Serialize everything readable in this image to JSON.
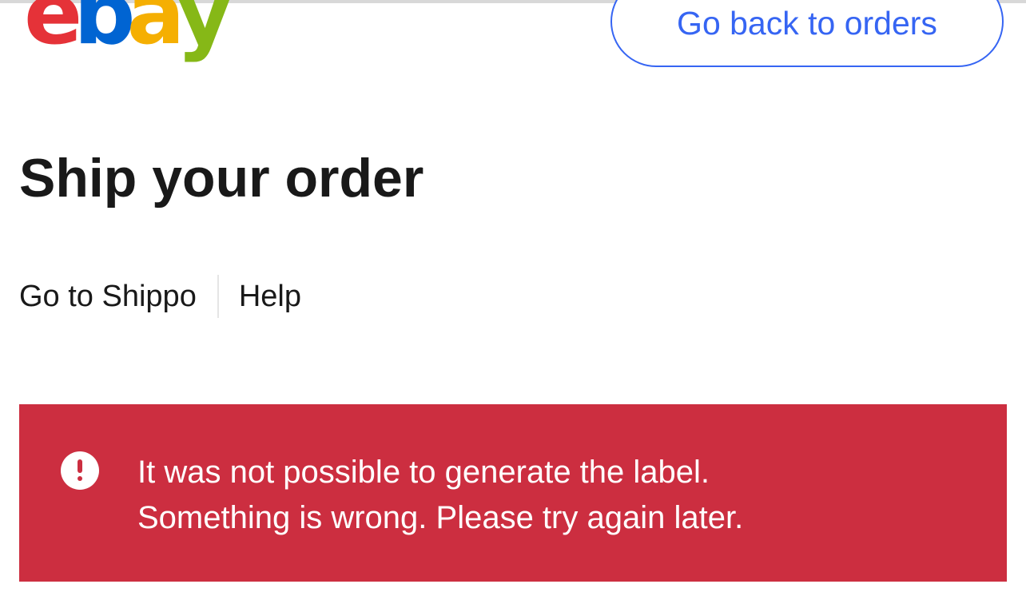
{
  "header": {
    "logo": {
      "text": "ebay",
      "letters": [
        {
          "char": "e",
          "color": "#e53238"
        },
        {
          "char": "b",
          "color": "#0064d2"
        },
        {
          "char": "a",
          "color": "#f5af02"
        },
        {
          "char": "y",
          "color": "#86b817"
        }
      ]
    },
    "back_button_label": "Go back to orders"
  },
  "main": {
    "title": "Ship your order",
    "links": {
      "shippo": "Go to Shippo",
      "help": "Help"
    },
    "alert": {
      "icon": "exclamation-circle-icon",
      "line1": "It was not possible to generate the label.",
      "line2": "Something is wrong. Please try again later.",
      "background_color": "#cc2e40"
    }
  },
  "colors": {
    "accent": "#3665f3",
    "text": "#191919",
    "error": "#cc2e40"
  }
}
